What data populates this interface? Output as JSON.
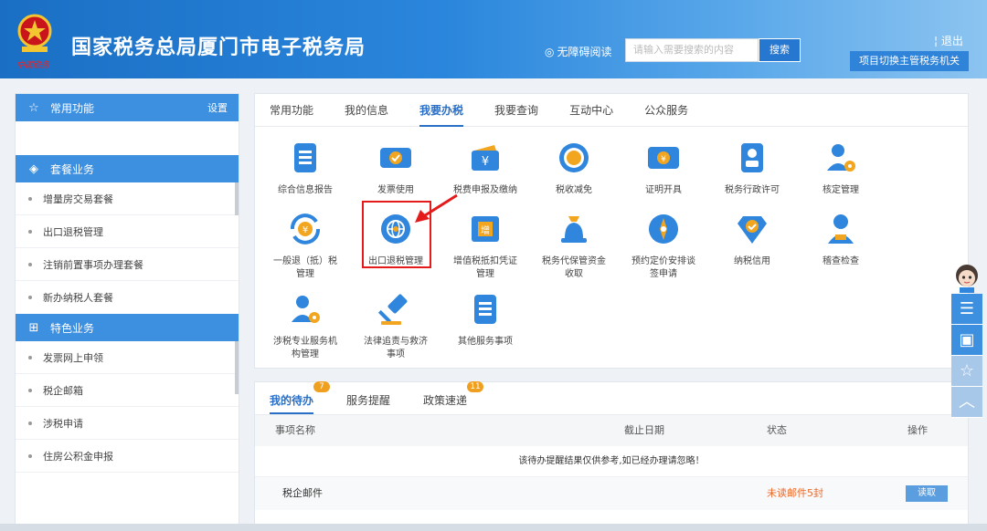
{
  "header": {
    "emblem_caption": "中国税务",
    "title": "国家税务总局厦门市电子税务局",
    "accessibility_label": "无障碍阅读",
    "search_placeholder": "请输入需要搜索的内容",
    "search_button": "搜索",
    "logout": "退出",
    "switch_authority": "项目切换主管税务机关"
  },
  "sidebar": {
    "common": {
      "label": "常用功能",
      "settings": "设置",
      "icon": "star-icon"
    },
    "packages": {
      "label": "套餐业务",
      "icon": "layers-icon",
      "items": [
        "增量房交易套餐",
        "出口退税管理",
        "注销前置事项办理套餐",
        "新办纳税人套餐"
      ]
    },
    "special": {
      "label": "特色业务",
      "icon": "grid-icon",
      "items": [
        "发票网上申领",
        "税企邮箱",
        "涉税申请",
        "住房公积金申报"
      ]
    }
  },
  "main": {
    "tabs": [
      "常用功能",
      "我的信息",
      "我要办税",
      "我要查询",
      "互动中心",
      "公众服务"
    ],
    "active_tab": "我要办税",
    "tiles": [
      {
        "label": "综合信息报告",
        "icon": "document-icon"
      },
      {
        "label": "发票使用",
        "icon": "ticket-icon"
      },
      {
        "label": "税费申报及缴纳",
        "icon": "wallet-icon"
      },
      {
        "label": "税收减免",
        "icon": "coin-icon"
      },
      {
        "label": "证明开具",
        "icon": "certificate-icon"
      },
      {
        "label": "税务行政许可",
        "icon": "id-card-icon"
      },
      {
        "label": "核定管理",
        "icon": "user-gear-icon"
      },
      {
        "label": "一般退（抵）税",
        "label2": "管理",
        "icon": "refund-icon"
      },
      {
        "label": "出口退税管理",
        "icon": "globe-icon"
      },
      {
        "label": "增值税抵扣凭证",
        "label2": "管理",
        "icon": "voucher-icon"
      },
      {
        "label": "税务代保管资金",
        "label2": "收取",
        "icon": "moneybag-icon"
      },
      {
        "label": "预约定价安排谈",
        "label2": "签申请",
        "icon": "compass-icon"
      },
      {
        "label": "纳税信用",
        "icon": "shield-check-icon"
      },
      {
        "label": "稽查检查",
        "icon": "person-icon"
      },
      {
        "label": "涉税专业服务机",
        "label2": "构管理",
        "icon": "agency-icon"
      },
      {
        "label": "法律追责与救济",
        "label2": "事项",
        "icon": "gavel-icon"
      },
      {
        "label": "其他服务事项",
        "icon": "list-icon"
      }
    ]
  },
  "todo": {
    "tabs": [
      {
        "label": "我的待办",
        "badge": "7"
      },
      {
        "label": "服务提醒",
        "badge": ""
      },
      {
        "label": "政策速递",
        "badge": "11"
      }
    ],
    "columns": [
      "事项名称",
      "截止日期",
      "状态",
      "操作"
    ],
    "notice": "该待办提醒结果仅供参考,如已经办理请忽略！",
    "rows": [
      {
        "name": "税企邮件",
        "deadline": "",
        "status": "未读邮件5封",
        "action": "读取"
      }
    ]
  },
  "colors": {
    "header_blue": "#2a86dc",
    "accent_blue": "#3d8fe0",
    "highlight_red": "#e51b1b",
    "badge_orange": "#f0a020"
  }
}
